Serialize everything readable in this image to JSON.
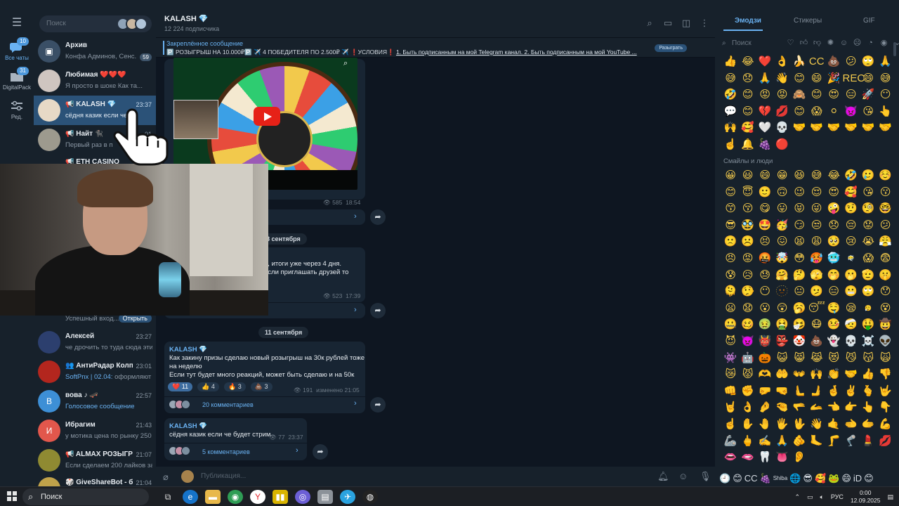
{
  "rail": {
    "items": [
      {
        "label": "Все чаты",
        "badge": "10"
      },
      {
        "label": "DigitalPack",
        "badge": "31"
      },
      {
        "label": "Ред."
      }
    ]
  },
  "chatlist": {
    "search_placeholder": "Поиск",
    "chats": [
      {
        "name": "Архив",
        "preview": "Конфа Админов, Сенс...",
        "count": "59"
      },
      {
        "name": "Любимая ❤️❤️❤️",
        "preview": "Я просто в шоке  Как та..."
      },
      {
        "name": "📢 KALASH 💎",
        "time": "23:37",
        "preview": "сёдня казик если че б"
      },
      {
        "name": "📢 Найт 🐈‍⬛",
        "time": "01",
        "preview": "Первый раз в п"
      },
      {
        "name": "📢 ETH CASINO",
        "preview": ""
      },
      {
        "name": "",
        "preview": "Успешный вход...",
        "button": "Открыть"
      },
      {
        "name": "Алексей",
        "time": "23:27",
        "preview": "че дрочить то туда сюда эти..."
      },
      {
        "name": "👥 АнтиРадар Колп...",
        "time": "23:01",
        "preview_accent": "SoftPnx | 02.04:",
        "preview": " оформляют"
      },
      {
        "name": "вова ♪ 🛹",
        "time": "22:57",
        "preview_accent": "Голосовое сообщение",
        "avatar_letter": "В"
      },
      {
        "name": "Ибрагим",
        "time": "21:43",
        "preview": "у мотика цена по рынку 250",
        "avatar_letter": "И"
      },
      {
        "name": "📢 ALMAX РОЗЫГРЫ...",
        "time": "21:07",
        "preview": "Если сделаем 200 лайков за ..."
      },
      {
        "name": "🎲 GiveShareBot - бо...",
        "time": "21:04",
        "preview": ""
      }
    ]
  },
  "header": {
    "title": "KALASH",
    "subtitle": "12 224 подписчика"
  },
  "pinned": {
    "label": "Закреплённое сообщение",
    "text_plain": "🅿️ РОЗЫГРЫШ НА 10.000₽🅿️ ✈️ 4 ПОБЕДИТЕЛЯ ПО 2.500₽ ✈️ ❗УСЛОВИЯ❗ ",
    "text_link": "1. Быть подписанным на мой Telegram канал.  2. Быть подписанным на мой YouTube ...",
    "button": "Разыграть"
  },
  "messages": {
    "video_meta": {
      "views": "585",
      "time": "18:54"
    },
    "msg2": {
      "date": "8 сентября",
      "line1": "й, итоги уже через 4 дня.",
      "line2": "если приглашать друзей то",
      "views": "523",
      "time": "17:39"
    },
    "date3": "11 сентября",
    "msg3": {
      "author": "KALASH 💎",
      "line1": "Как закину призы сделаю новый розыгрыш на 30к рублей тоже",
      "line2": "на неделю",
      "line3": "Если тут будет много реакций, может быть сделаю и на 50к",
      "reactions": [
        {
          "emoji": "❤️",
          "count": "11"
        },
        {
          "emoji": "👍",
          "count": "4"
        },
        {
          "emoji": "🔥",
          "count": "3"
        },
        {
          "emoji": "💩",
          "count": "3"
        }
      ],
      "views": "191",
      "edited": "изменено",
      "time": "21:05",
      "comments": "20 комментариев"
    },
    "msg4": {
      "author": "KALASH 💎",
      "text": "сёдня казик если че будет стрим",
      "views": "77",
      "time": "23:37",
      "comments": "5 комментариев"
    }
  },
  "composer": {
    "placeholder": "Публикация..."
  },
  "emoji_panel": {
    "tabs": [
      "Эмодзи",
      "Стикеры",
      "GIF"
    ],
    "search_placeholder": "Поиск",
    "section_title": "Смайлы и люди",
    "recent": [
      "👍",
      "😂",
      "❤️",
      "👌",
      "🍌",
      "CC",
      "💩",
      "😕",
      "🙄",
      "🙏",
      "😅",
      "😞",
      "🙏",
      "👋",
      "😊",
      "😄",
      "🎉",
      "REC",
      "😄",
      "😅",
      "🤣",
      "😊",
      "😡",
      "😡",
      "🙈",
      "😊",
      "😍",
      "😑",
      "🚀",
      "😶",
      "💬",
      "😊",
      "💔",
      "💋",
      "😊",
      "😱",
      "⚪",
      "👿",
      "😘",
      "👆",
      "🙌",
      "🥰",
      "🤍",
      "💀",
      "🤝",
      "🤝",
      "🤝",
      "🤝",
      "🤝",
      "🤝",
      "☝️",
      "🔔",
      "🍇",
      "🔴"
    ],
    "faces": [
      "😀",
      "😃",
      "😄",
      "😁",
      "😆",
      "😅",
      "😂",
      "🤣",
      "🥲",
      "☺️",
      "😊",
      "😇",
      "🙂",
      "🙃",
      "😉",
      "😌",
      "😍",
      "🥰",
      "😘",
      "😗",
      "😙",
      "😚",
      "😋",
      "😛",
      "😝",
      "😜",
      "🤪",
      "🤨",
      "🧐",
      "🤓",
      "😎",
      "🥸",
      "🤩",
      "🥳",
      "😏",
      "😒",
      "😞",
      "😔",
      "😟",
      "😕",
      "🙁",
      "☹️",
      "😣",
      "😖",
      "😫",
      "😩",
      "🥺",
      "😢",
      "😭",
      "😤",
      "😠",
      "😡",
      "🤬",
      "🤯",
      "😳",
      "🥵",
      "🥶",
      "😶‍🌫️",
      "😱",
      "😨",
      "😰",
      "😥",
      "😓",
      "🤗",
      "🤔",
      "🫣",
      "🤭",
      "🫢",
      "🫡",
      "🤫",
      "🫠",
      "🤥",
      "😶",
      "🫥",
      "😐",
      "🫤",
      "😑",
      "😬",
      "🙄",
      "😯",
      "😦",
      "😧",
      "😮",
      "😲",
      "🥱",
      "😴",
      "🤤",
      "😪",
      "😮‍💨",
      "😵",
      "🤐",
      "🥴",
      "🤢",
      "🤮",
      "🤧",
      "😷",
      "🤒",
      "🤕",
      "🤑",
      "🤠",
      "😈",
      "👿",
      "👹",
      "👺",
      "🤡",
      "💩",
      "👻",
      "💀",
      "☠️",
      "👽",
      "👾",
      "🤖",
      "🎃",
      "😺",
      "😸",
      "😹",
      "😻",
      "😼",
      "😽",
      "🙀",
      "😿",
      "😾",
      "🫶",
      "🤲",
      "👐",
      "🙌",
      "👏",
      "🤝",
      "👍",
      "👎",
      "👊",
      "✊",
      "🤛",
      "🤜",
      "🫷",
      "🫸",
      "🤞",
      "✌️",
      "🫰",
      "🤟",
      "🤘",
      "👌",
      "🤌",
      "🤏",
      "🫳",
      "🫴",
      "👈",
      "👉",
      "👆",
      "👇",
      "☝️",
      "✋",
      "🤚",
      "🖐️",
      "🖖",
      "👋",
      "🤙",
      "🫲",
      "🫱",
      "💪",
      "🦾",
      "🖕",
      "✍️",
      "🙏",
      "🫵",
      "🦶",
      "🦵",
      "🦿",
      "💄",
      "💋",
      "👄",
      "🫦",
      "🦷",
      "👅",
      "👂"
    ],
    "bottom": [
      "🕘",
      "😊",
      "CC",
      "🍇",
      "Shiba",
      "🌐",
      "😎",
      "🥰",
      "🐸",
      "😄",
      "iD",
      "😊"
    ]
  },
  "taskbar": {
    "search": "Поиск",
    "lang": "РУС",
    "time": "0:00",
    "date": "12.09.2025"
  }
}
